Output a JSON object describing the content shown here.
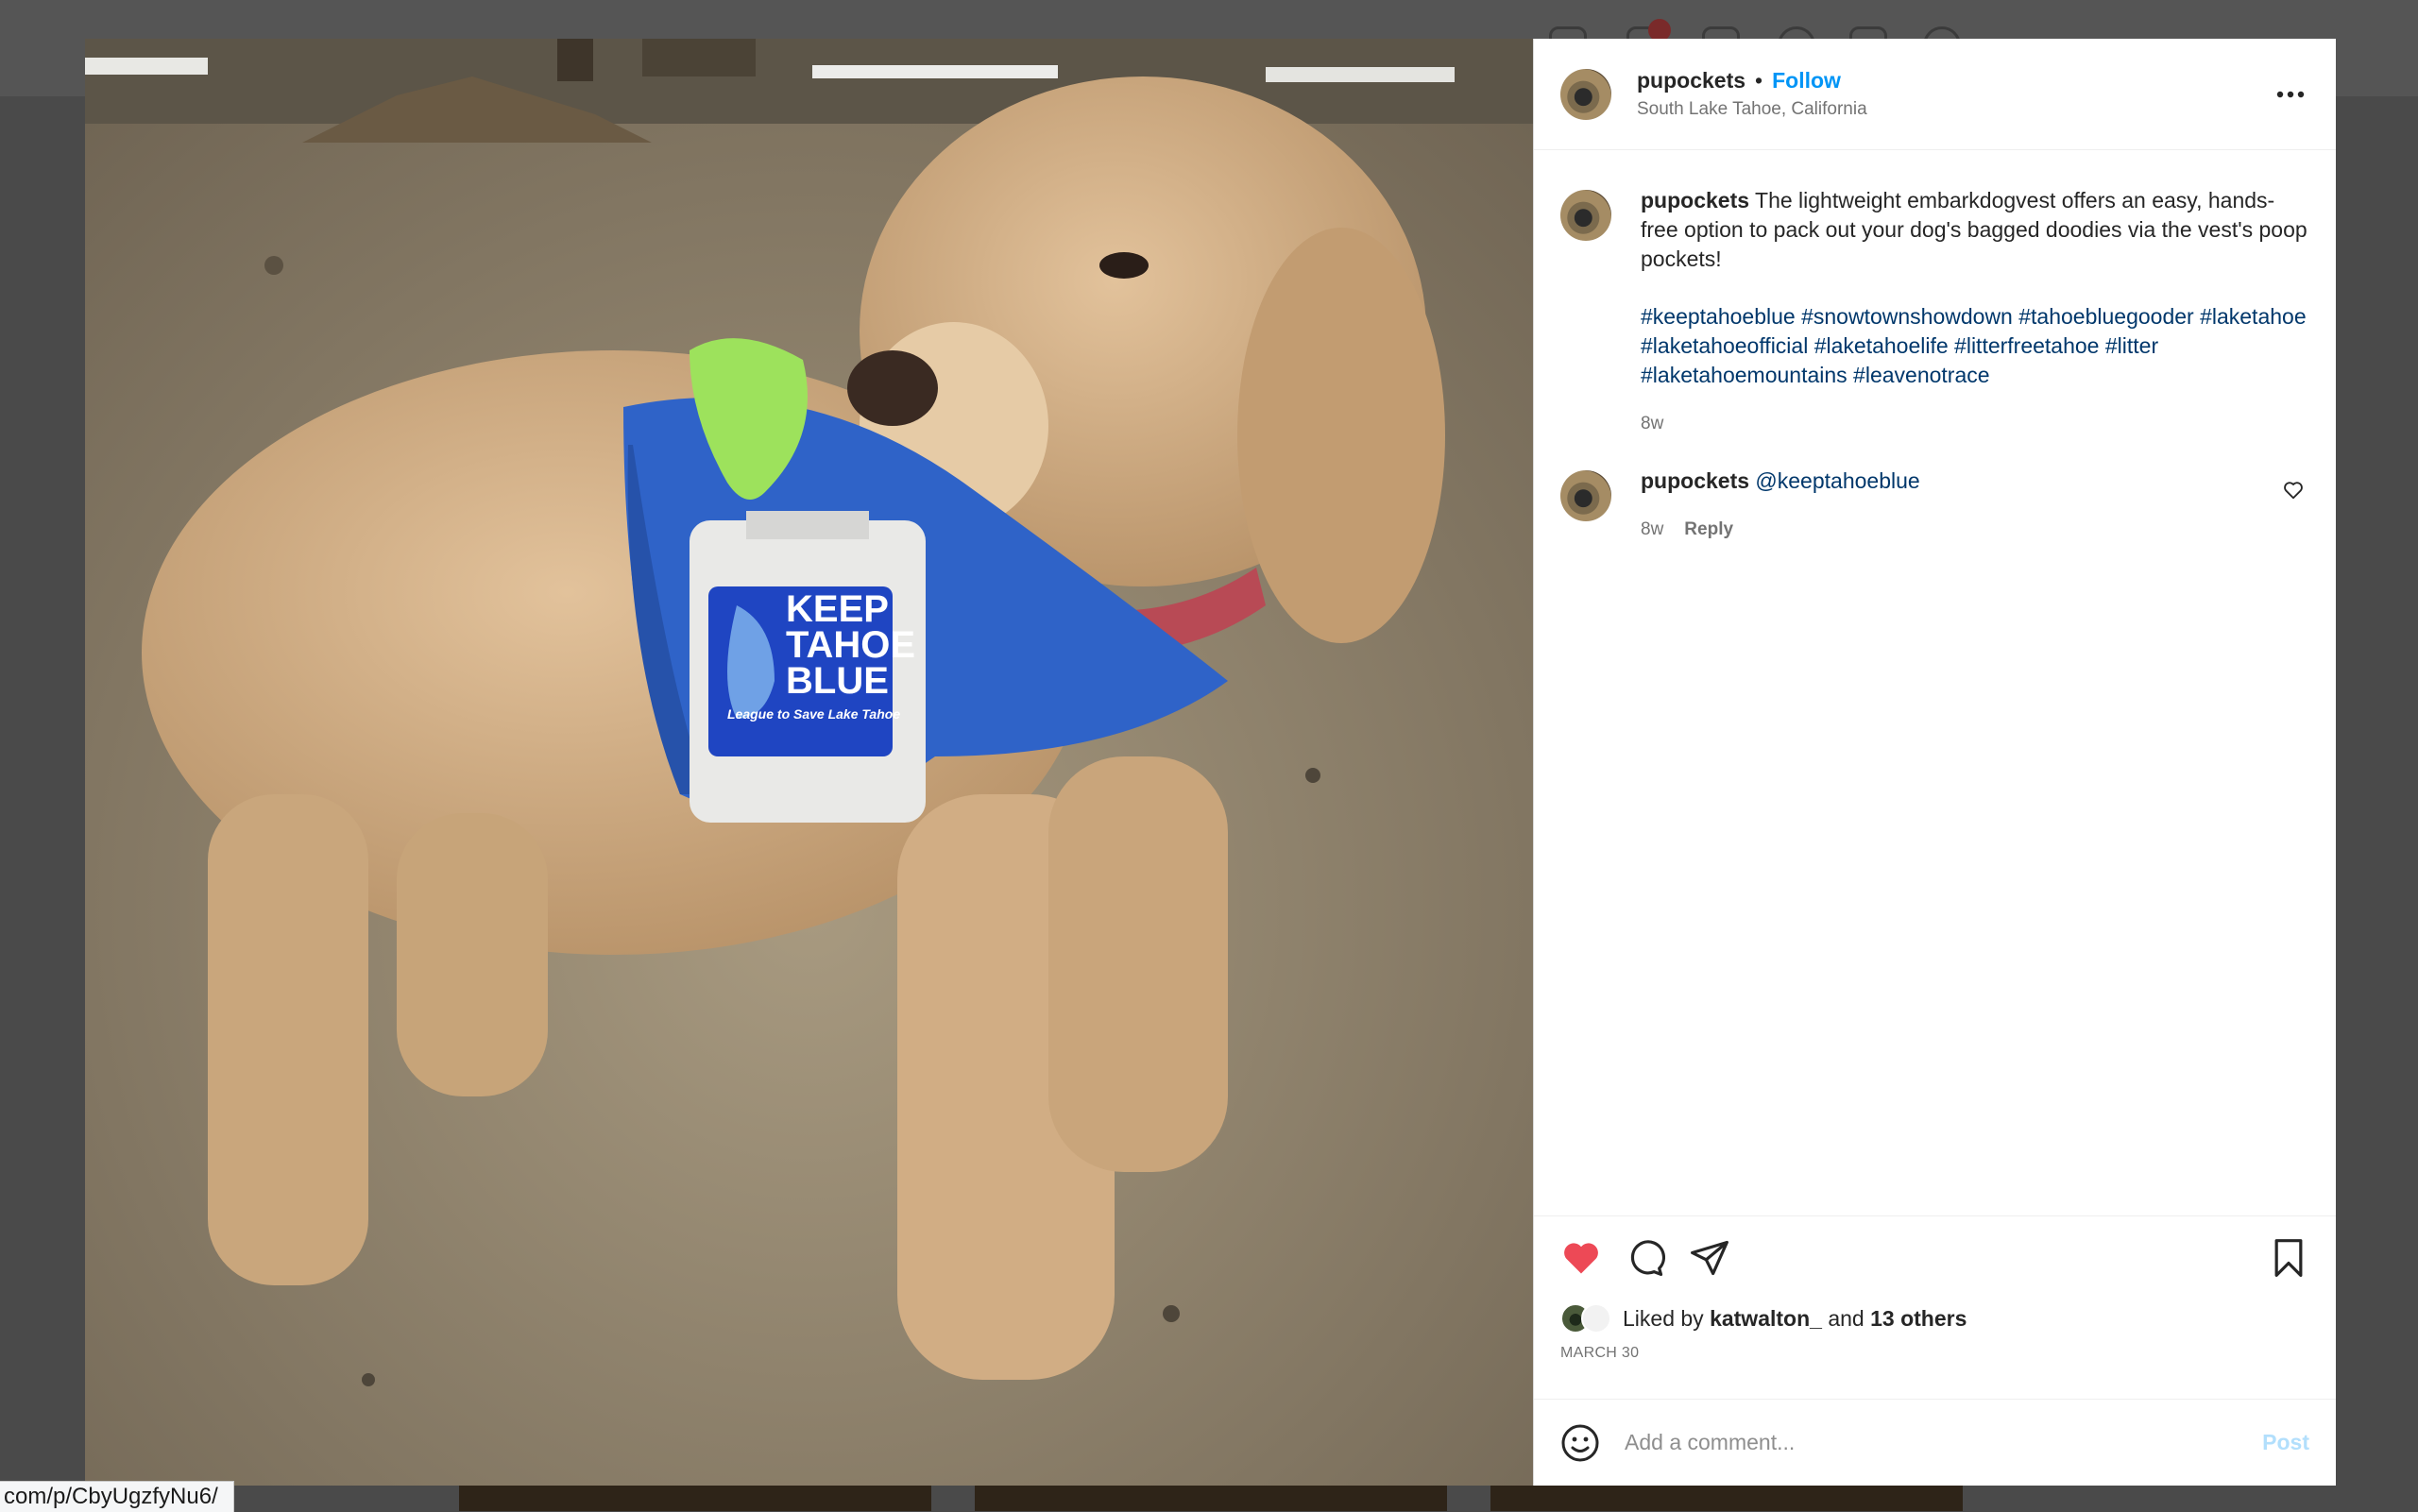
{
  "post": {
    "username": "pupockets",
    "separator": "•",
    "follow_label": "Follow",
    "location": "South Lake Tahoe, California"
  },
  "caption": {
    "username": "pupockets",
    "text": "The lightweight embarkdogvest offers an easy, hands-free option to pack out your dog's bagged doodies via the vest's poop pockets!",
    "hashtags": "#keeptahoeblue #snowtownshowdown #tahoebluegooder #laketahoe #laketahoeofficial #laketahoelife #litterfreetahoe #litter #laketahoemountains #leavenotrace",
    "age": "8w"
  },
  "comment": {
    "username": "pupockets",
    "text": "@keeptahoeblue",
    "age": "8w",
    "reply_label": "Reply"
  },
  "likes": {
    "prefix": "Liked by",
    "user": "katwalton_",
    "middle": "and",
    "others": "13 others"
  },
  "date": "MARCH 30",
  "add_comment": {
    "placeholder": "Add a comment...",
    "post_label": "Post"
  },
  "vest_patch": {
    "line1": "KEEP",
    "line2": "TAHOE",
    "line3": "BLUE",
    "tagline": "League to Save Lake Tahoe"
  },
  "status_url": "com/p/CbyUgzfyNu6/",
  "colors": {
    "accent": "#0095f6",
    "like": "#ed4956",
    "hashtag": "#00376b",
    "vest": "#2f63c8"
  },
  "icons": [
    "more-icon",
    "heart-icon",
    "comment-icon",
    "share-icon",
    "bookmark-icon",
    "emoji-icon",
    "heart-outline-icon"
  ]
}
